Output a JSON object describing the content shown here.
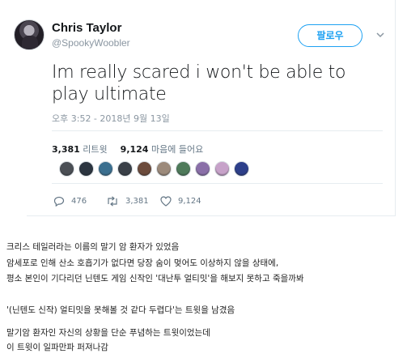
{
  "tweet": {
    "display_name": "Chris Taylor",
    "handle": "@SpookyWoobler",
    "follow_label": "팔로우",
    "text": "Im really scared i won't be able to play ultimate",
    "timestamp": "오후 3:52 - 2018년 9월 13일",
    "retweets_count": "3,381",
    "retweets_label": "리트윗",
    "likes_count": "9,124",
    "likes_label": "마음에 들어요",
    "liker_colors": [
      "#4b4f55",
      "#2c3540",
      "#3b6f8f",
      "#3a4048",
      "#6c4b3c",
      "#9c8a7b",
      "#4e7a5a",
      "#8a6fa8",
      "#c7a2c9",
      "#2d3f8a"
    ],
    "actions": {
      "reply_count": "476",
      "retweet_count": "3,381",
      "like_count": "9,124"
    },
    "accent": "#1da1f2"
  },
  "body": {
    "lines": [
      "크리스 테일러라는 이름의 말기 암 환자가 있었음",
      "암세포로 인해 산소 호흡기가 없다면 당장 숨이 멎어도 이상하지 않을 상태에,",
      "평소 본인이 기다리던 닌텐도 게임 신작인 '대난투 얼티밋'을 해보지 못하고 죽을까봐",
      "'(닌텐도 신작) 얼티밋을 못해볼 것 같다 두렵다'는 트윗을 남겼음",
      "말기암 환자인 자신의 상황을 단순 푸념하는 트윗이었는데",
      "이 트윗이 일파만파 퍼져나감"
    ]
  }
}
